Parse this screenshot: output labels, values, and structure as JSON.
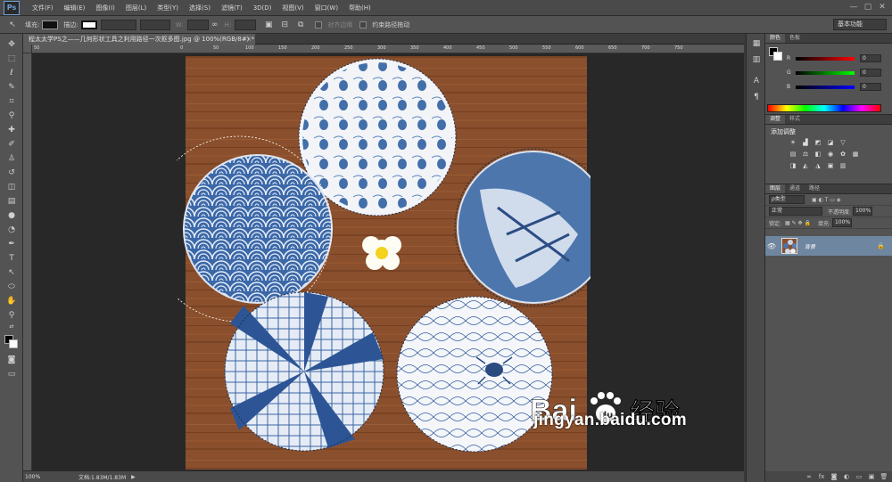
{
  "app": {
    "logo": "Ps"
  },
  "menu": [
    "文件(F)",
    "编辑(E)",
    "图像(I)",
    "图层(L)",
    "类型(Y)",
    "选择(S)",
    "滤镜(T)",
    "3D(D)",
    "视图(V)",
    "窗口(W)",
    "帮助(H)"
  ],
  "window_controls": [
    "—",
    "▢",
    "✕"
  ],
  "options": {
    "fill_label": "填充:",
    "stroke_label": "描边:",
    "w_label": "W:",
    "h_label": "H:",
    "align_edges": "对齐边缘",
    "constrain_path": "约束路径拖动",
    "workspace": "基本功能"
  },
  "document": {
    "tab_title": "程太太学PS之——几何形状工具之利用路径一次抠多图.jpg @ 100%(RGB/8#) *",
    "ruler_marks": [
      "50",
      "0",
      "50",
      "100",
      "150",
      "200",
      "250",
      "300",
      "350",
      "400",
      "450",
      "500",
      "550",
      "600",
      "650",
      "700",
      "750"
    ],
    "zoom": "100%",
    "doc_info": "文档:1.83M/1.83M"
  },
  "panels": {
    "color_tabs": [
      "颜色",
      "色板"
    ],
    "sliders": [
      {
        "label": "R",
        "value": "0",
        "color": "#d33"
      },
      {
        "label": "G",
        "value": "0",
        "color": "#3c3"
      },
      {
        "label": "B",
        "value": "0",
        "color": "#33d"
      }
    ],
    "adjust_tabs": [
      "调整",
      "样式"
    ],
    "adjust_title": "添加调整",
    "layers_tabs": [
      "图层",
      "通道",
      "路径"
    ],
    "kind_filter": "ρ类型",
    "blend_mode": "正常",
    "opacity_label": "不透明度:",
    "opacity_value": "100%",
    "lock_label": "锁定:",
    "fill_label": "填充:",
    "fill_value": "100%",
    "layer_name": "背景"
  },
  "watermark": {
    "brand": "Bai百经验",
    "url": "jingyan.baidu.com"
  }
}
